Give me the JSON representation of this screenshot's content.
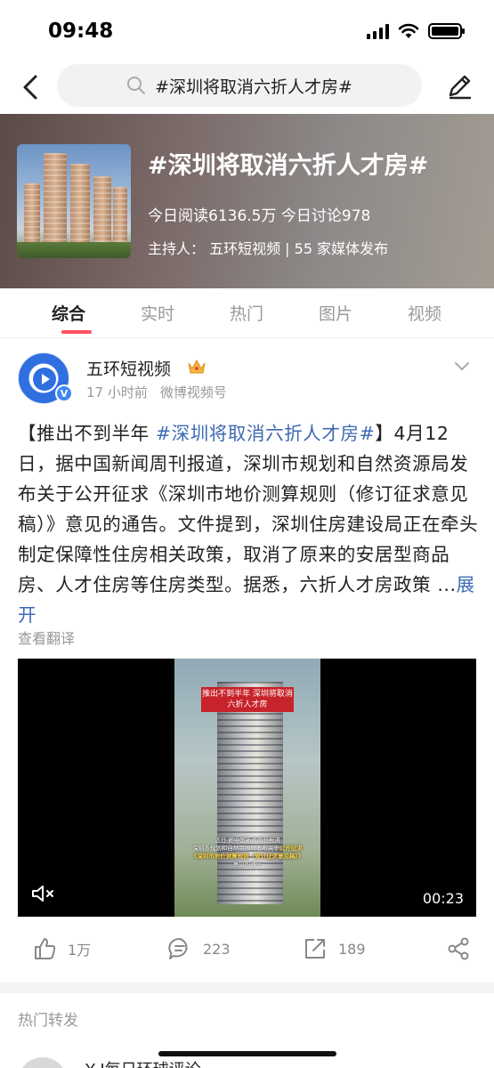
{
  "status_bar": {
    "time": "09:48"
  },
  "header": {
    "search_query": "#深圳将取消六折人才房#"
  },
  "topic": {
    "title": "#深圳将取消六折人才房#",
    "stats": "今日阅读6136.5万  今日讨论978",
    "host": "主持人： 五环短视频 | 55 家媒体发布"
  },
  "tabs": [
    {
      "label": "综合",
      "active": true
    },
    {
      "label": "实时"
    },
    {
      "label": "热门"
    },
    {
      "label": "图片"
    },
    {
      "label": "视频"
    }
  ],
  "post": {
    "author": "五环短视频",
    "time": "17 小时前",
    "source": "微博视频号",
    "text_prefix": "【推出不到半年 ",
    "hashtag": "#深圳将取消六折人才房#",
    "text_body": "】4月12日，据中国新闻周刊报道，深圳市规划和自然资源局发布关于公开征求《深圳市地价测算规则（修订征求意见稿）》意见的通告。文件提到，深圳住房建设局正在牵头制定保障性住房相关政策，取消了原来的安居型商品房、人才住房等住房类型。据悉，六折人才房政策 ...",
    "expand": "展开",
    "translate": "查看翻译",
    "video": {
      "duration": "00:23",
      "caption_top": "推出不到半年 深圳将取消六折人才房",
      "caption_bottom_1": "近日 据中国新闻周刊报道",
      "caption_bottom_2": "深圳市规划和自然资源局发布关于",
      "caption_bottom_highlight": "公开征求",
      "caption_bottom_3": "《深圳市地价测算规则（修订征求意见稿）》",
      "caption_bottom_4": "意见的通告"
    },
    "likes": "1万",
    "comments": "223",
    "reposts": "189"
  },
  "section": {
    "title": "热门转发"
  },
  "next_post": {
    "author": "Y-J每日环球评论"
  },
  "icons": {
    "back": "chevron-left-icon",
    "search": "search-icon",
    "edit": "pencil-icon",
    "crown": "crown-icon",
    "more": "chevron-down-icon",
    "mute": "mute-icon",
    "like": "thumb-up-icon",
    "comment": "comment-icon",
    "repost": "repost-icon",
    "share": "share-icon"
  },
  "colors": {
    "accent": "#ff4f5e",
    "link": "#3e6ab3",
    "verified": "#3d86f4"
  }
}
